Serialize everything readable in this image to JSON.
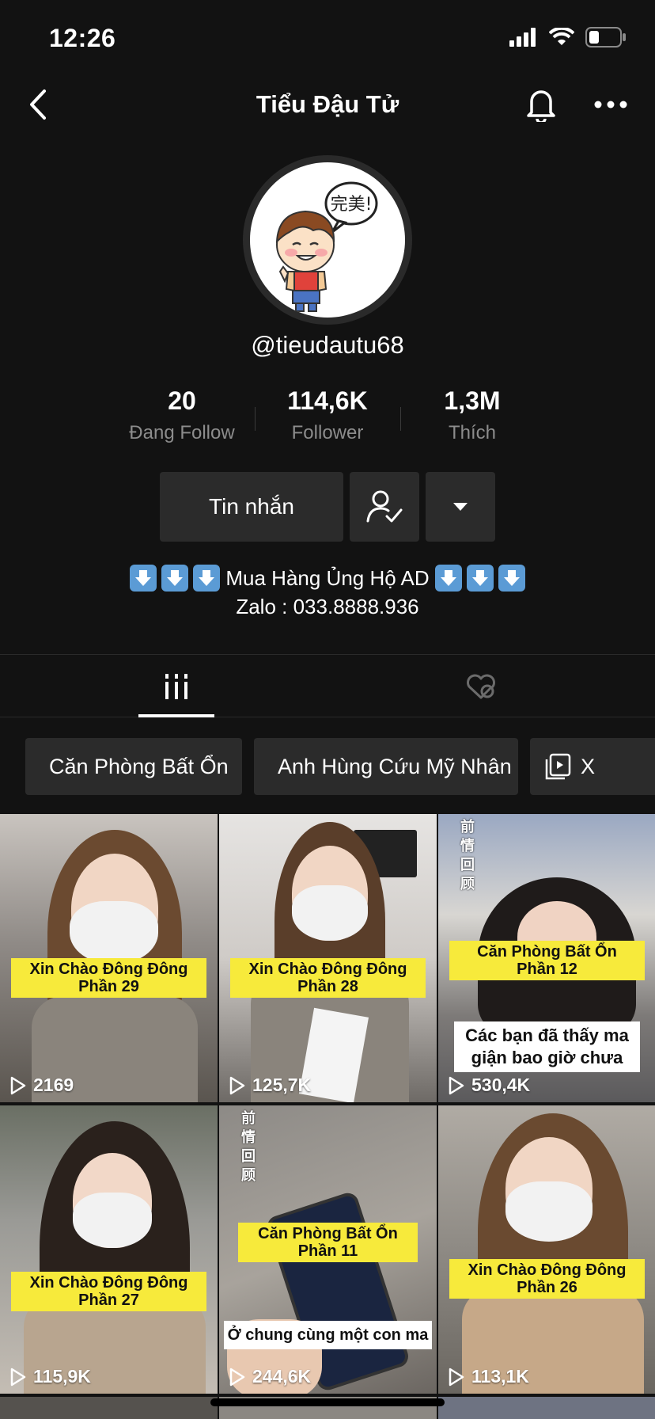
{
  "status_bar": {
    "time": "12:26"
  },
  "nav": {
    "title": "Tiểu Đậu Tử"
  },
  "profile": {
    "username": "@tieudautu68",
    "avatar_speech": "完美!"
  },
  "stats": [
    {
      "value": "20",
      "label": "Đang Follow"
    },
    {
      "value": "114,6K",
      "label": "Follower"
    },
    {
      "value": "1,3M",
      "label": "Thích"
    }
  ],
  "actions": {
    "message_label": "Tin nhắn"
  },
  "bio": {
    "line1": "Mua Hàng Ủng Hộ AD",
    "line2": "Zalo : 033.8888.936"
  },
  "playlists": [
    {
      "label": "Căn Phòng Bất Ổn"
    },
    {
      "label": "Anh Hùng Cứu Mỹ Nhân"
    },
    {
      "label": "X"
    }
  ],
  "videos": [
    {
      "caption1": "Xin Chào Đông Đông",
      "caption2": "Phần 29",
      "views": "2169"
    },
    {
      "caption1": "Xin Chào Đông Đông",
      "caption2": "Phần 28",
      "views": "125,7K"
    },
    {
      "caption1": "Căn Phòng Bất Ổn",
      "caption2": "Phần 12",
      "subcaption": "Các bạn đã thấy ma giận bao giờ chưa",
      "side_text": "前情回顾",
      "views": "530,4K"
    },
    {
      "caption1": "Xin Chào Đông Đông",
      "caption2": "Phần 27",
      "views": "115,9K"
    },
    {
      "caption1": "Căn Phòng Bất Ổn",
      "caption2": "Phần 11",
      "subcaption": "Ở chung cùng một con ma",
      "side_text": "前情回顾",
      "views": "244,6K"
    },
    {
      "caption1": "Xin Chào Đông Đông",
      "caption2": "Phần 26",
      "views": "113,1K"
    }
  ],
  "colors": {
    "background": "#121212",
    "caption_yellow": "#f7ea3b",
    "button_bg": "#2b2b2b"
  }
}
